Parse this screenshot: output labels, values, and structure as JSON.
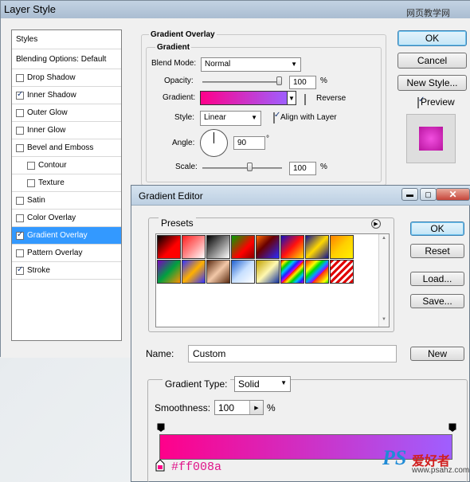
{
  "watermarks": {
    "top_right": "网页教学网",
    "bottom_logo": "PS",
    "bottom_cn": "爱好者",
    "bottom_url": "www.psahz.com"
  },
  "layer_style": {
    "title": "Layer Style",
    "styles_header": "Styles",
    "blending_options": "Blending Options: Default",
    "items": [
      {
        "label": "Drop Shadow",
        "checked": false
      },
      {
        "label": "Inner Shadow",
        "checked": true
      },
      {
        "label": "Outer Glow",
        "checked": false
      },
      {
        "label": "Inner Glow",
        "checked": false
      },
      {
        "label": "Bevel and Emboss",
        "checked": false
      },
      {
        "label": "Contour",
        "checked": false
      },
      {
        "label": "Texture",
        "checked": false
      },
      {
        "label": "Satin",
        "checked": false
      },
      {
        "label": "Color Overlay",
        "checked": false
      },
      {
        "label": "Gradient Overlay",
        "checked": true
      },
      {
        "label": "Pattern Overlay",
        "checked": false
      },
      {
        "label": "Stroke",
        "checked": true
      }
    ],
    "section_title": "Gradient Overlay",
    "subsection_title": "Gradient",
    "blend_mode_label": "Blend Mode:",
    "blend_mode_value": "Normal",
    "opacity_label": "Opacity:",
    "opacity_value": "100",
    "percent": "%",
    "gradient_label": "Gradient:",
    "reverse_label": "Reverse",
    "style_label": "Style:",
    "style_value": "Linear",
    "align_label": "Align with Layer",
    "angle_label": "Angle:",
    "angle_value": "90",
    "degree": "°",
    "scale_label": "Scale:",
    "scale_value": "100",
    "ok": "OK",
    "cancel": "Cancel",
    "new_style": "New Style...",
    "preview": "Preview"
  },
  "gradient_editor": {
    "title": "Gradient Editor",
    "presets_label": "Presets",
    "ok": "OK",
    "reset": "Reset",
    "load": "Load...",
    "save": "Save...",
    "name_label": "Name:",
    "name_value": "Custom",
    "new": "New",
    "gradient_type_label": "Gradient Type:",
    "gradient_type_value": "Solid",
    "smoothness_label": "Smoothness:",
    "smoothness_value": "100",
    "percent": "%",
    "stop_color_label": "#ff008a",
    "colors": {
      "start": "#ff008a",
      "end": "#9f5fff"
    }
  }
}
